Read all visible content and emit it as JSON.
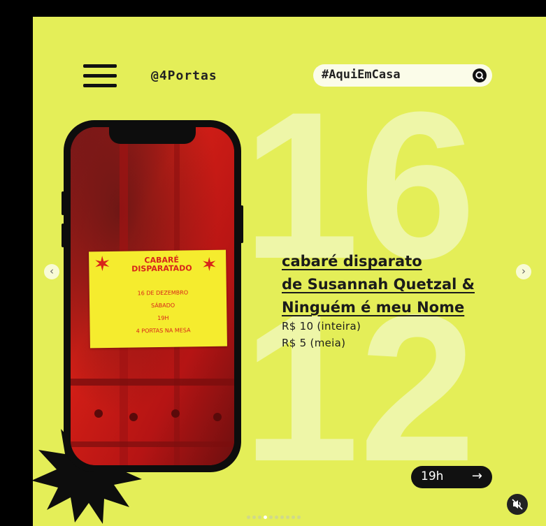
{
  "header": {
    "handle": "@4Portas",
    "hashtag": "#AquiEmCasa"
  },
  "date_big": {
    "day": "16",
    "month": "12"
  },
  "event": {
    "title_lines": [
      "cabaré disparato",
      "de Susannah Quetzal &",
      "Ninguém é meu Nome"
    ],
    "price_full": "R$ 10 (inteira)",
    "price_half": "R$ 5 (meia)",
    "time": "19h",
    "time_arrow": "→"
  },
  "phone_note": {
    "title_top": "CABARÉ",
    "title_bottom": "DISPARATADO",
    "lines": [
      "16 DE DEZEMBRO",
      "SÁBADO",
      "19H",
      "4 PORTAS NA MESA"
    ]
  },
  "carousel": {
    "prev_symbol": "‹",
    "next_symbol": "›",
    "dot_count": 10,
    "active_dot": 3
  },
  "icons": {
    "menu": "hamburger-menu-icon",
    "search": "search-icon",
    "mute": "muted-speaker-icon",
    "starburst": "starburst-icon"
  },
  "colors": {
    "background": "#e4ee58",
    "big_numbers": "#eef6a8",
    "text": "#1b1b1b",
    "phone_screen": "#c21616",
    "note": "#f5ec2e",
    "note_ink": "#d8251a"
  }
}
